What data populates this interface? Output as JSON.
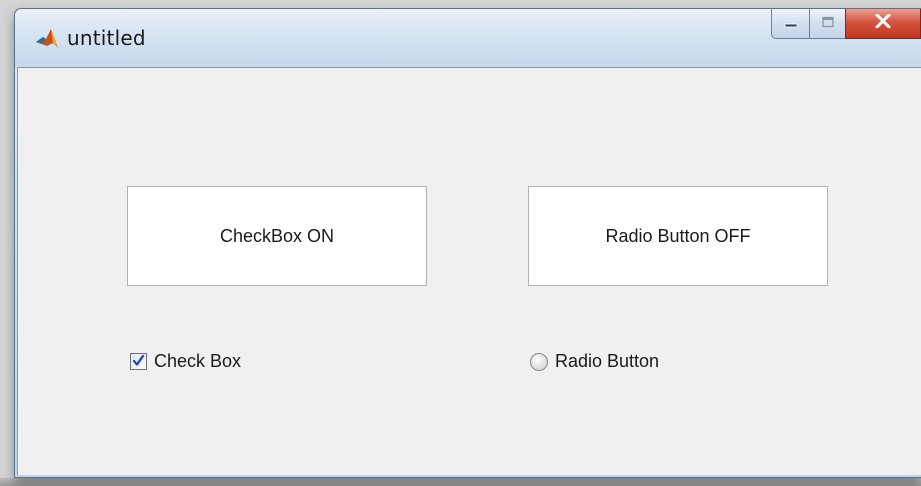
{
  "window": {
    "title": "untitled"
  },
  "caption_buttons": {
    "minimize_icon": "minimize-icon",
    "maximize_icon": "maximize-icon",
    "close_icon": "close-icon"
  },
  "panels": {
    "checkbox_status": "CheckBox ON",
    "radio_status": "Radio Button OFF"
  },
  "controls": {
    "checkbox": {
      "label": "Check Box",
      "checked": true
    },
    "radio": {
      "label": "Radio Button",
      "selected": false
    }
  },
  "colors": {
    "client_bg": "#f0f0f0",
    "close_button": "#c7402a",
    "check_mark": "#2a4fa8"
  }
}
